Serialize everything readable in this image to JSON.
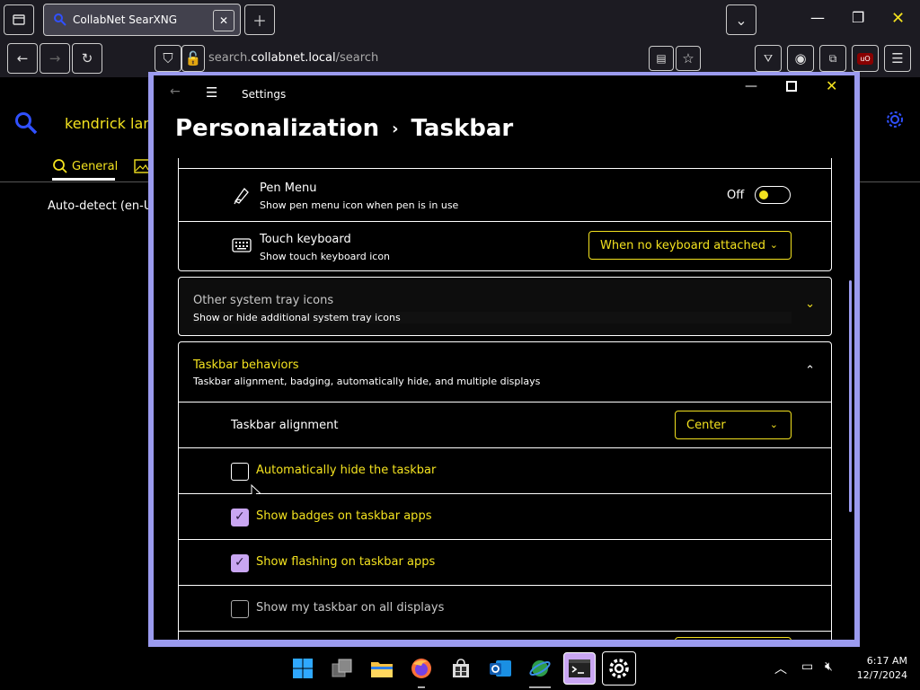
{
  "browser": {
    "tab_title": "CollabNet SearXNG",
    "url_domain": "search.",
    "url_host": "collabnet.local",
    "url_path": "/search"
  },
  "search_page": {
    "query": "kendrick lama",
    "general_tab": "General",
    "language": "Auto-detect (en-US"
  },
  "settings": {
    "window_title": "Settings",
    "breadcrumb_parent": "Personalization",
    "breadcrumb_current": "Taskbar",
    "pen_menu": {
      "title": "Pen Menu",
      "subtitle": "Show pen menu icon when pen is in use",
      "toggle_label": "Off"
    },
    "touch_keyboard": {
      "title": "Touch keyboard",
      "subtitle": "Show touch keyboard icon",
      "dropdown_value": "When no keyboard attached"
    },
    "other_tray": {
      "title": "Other system tray icons",
      "subtitle": "Show or hide additional system tray icons"
    },
    "behaviors": {
      "title": "Taskbar behaviors",
      "subtitle": "Taskbar alignment, badging, automatically hide, and multiple displays",
      "alignment_label": "Taskbar alignment",
      "alignment_value": "Center",
      "auto_hide": "Automatically hide the taskbar",
      "badges": "Show badges on taskbar apps",
      "flashing": "Show flashing on taskbar apps",
      "all_displays": "Show my taskbar on all displays"
    }
  },
  "taskbar": {
    "time": "6:17 AM",
    "date": "12/7/2024"
  },
  "colors": {
    "accent_yellow": "#f3e21f",
    "window_border": "#9b9bef",
    "checkbox_checked": "#c9a6f2"
  }
}
